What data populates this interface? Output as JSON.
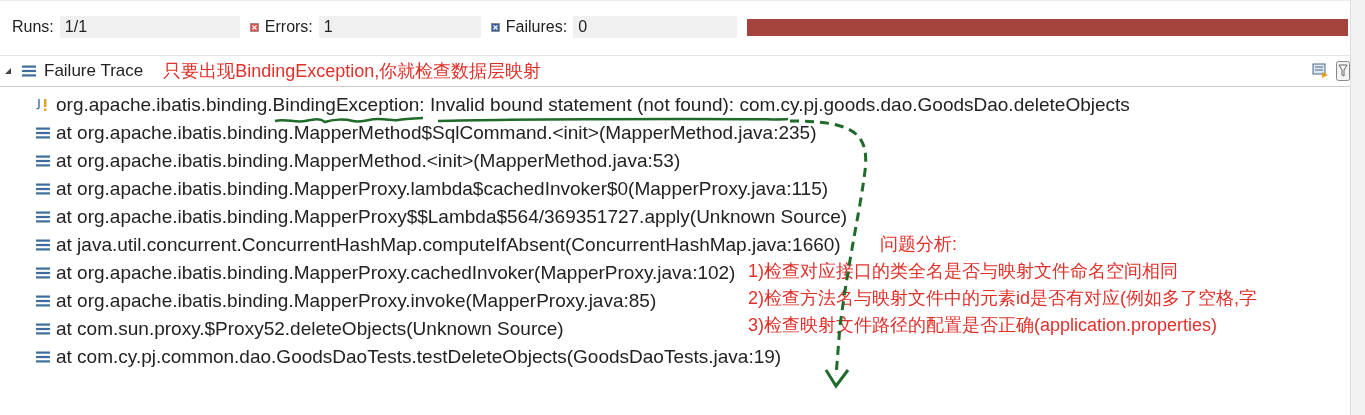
{
  "counters": [
    {
      "kind": "runs",
      "label": "Runs:",
      "value": "1/1"
    },
    {
      "kind": "errors",
      "label": "Errors:",
      "value": "1"
    },
    {
      "kind": "failures",
      "label": "Failures:",
      "value": "0"
    }
  ],
  "progress": {
    "level": 1
  },
  "trace_panel": {
    "title": "Failure Trace",
    "expanded": true,
    "note": "只要出现BindingException,你就检查数据层映射"
  },
  "trace": [
    {
      "kind": "exception",
      "text": "org.apache.ibatis.binding.BindingException: Invalid bound statement (not found): com.cy.pj.goods.dao.GoodsDao.deleteObjects"
    },
    {
      "kind": "frame",
      "text": "at org.apache.ibatis.binding.MapperMethod$SqlCommand.<init>(MapperMethod.java:235)"
    },
    {
      "kind": "frame",
      "text": "at org.apache.ibatis.binding.MapperMethod.<init>(MapperMethod.java:53)"
    },
    {
      "kind": "frame",
      "text": "at org.apache.ibatis.binding.MapperProxy.lambda$cachedInvoker$0(MapperProxy.java:115)"
    },
    {
      "kind": "frame",
      "text": "at org.apache.ibatis.binding.MapperProxy$$Lambda$564/369351727.apply(Unknown Source)"
    },
    {
      "kind": "frame",
      "text": "at java.util.concurrent.ConcurrentHashMap.computeIfAbsent(ConcurrentHashMap.java:1660)"
    },
    {
      "kind": "frame",
      "text": "at org.apache.ibatis.binding.MapperProxy.cachedInvoker(MapperProxy.java:102)"
    },
    {
      "kind": "frame",
      "text": "at org.apache.ibatis.binding.MapperProxy.invoke(MapperProxy.java:85)"
    },
    {
      "kind": "frame",
      "text": "at com.sun.proxy.$Proxy52.deleteObjects(Unknown Source)"
    },
    {
      "kind": "frame",
      "text": "at com.cy.pj.common.dao.GoodsDaoTests.testDeleteObjects(GoodsDaoTests.java:19)"
    }
  ],
  "analysis": {
    "title": "问题分析:",
    "points": [
      "1)检查对应接口的类全名是否与映射文件命名空间相同",
      "2)检查方法名与映射文件中的元素id是否有对应(例如多了空格,字",
      "3)检查映射文件路径的配置是否正确(application.properties)"
    ]
  }
}
